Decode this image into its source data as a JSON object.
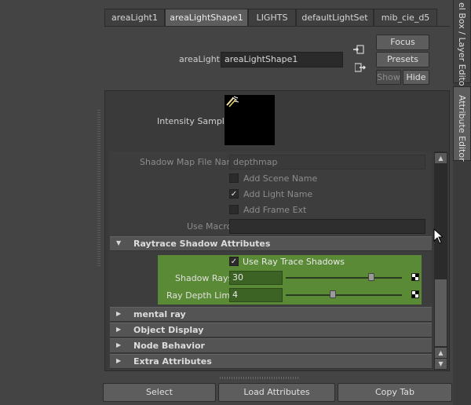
{
  "tabs": [
    "areaLight1",
    "areaLightShape1",
    "LIGHTS",
    "defaultLightSet",
    "mib_cie_d5"
  ],
  "node": {
    "label": "areaLight:",
    "value": "areaLightShape1"
  },
  "buttons": {
    "focus": "Focus",
    "presets": "Presets",
    "show": "Show",
    "hide": "Hide"
  },
  "intensity_sample": {
    "label": "Intensity Sample"
  },
  "shadow_map": {
    "file_name_label": "Shadow Map File Name",
    "file_name_value": "depthmap",
    "add_scene_name": "Add Scene Name",
    "add_light_name": "Add Light Name",
    "add_frame_ext": "Add Frame Ext",
    "use_macro_label": "Use Macro",
    "use_macro_value": ""
  },
  "raytrace": {
    "title": "Raytrace Shadow Attributes",
    "use_ray_trace_shadows": "Use Ray Trace Shadows",
    "shadow_rays_label": "Shadow Rays",
    "shadow_rays_value": "30",
    "ray_depth_label": "Ray Depth Limit",
    "ray_depth_value": "4"
  },
  "sections": [
    "mental ray",
    "Object Display",
    "Node Behavior",
    "Extra Attributes"
  ],
  "bottom_buttons": {
    "select": "Select",
    "load": "Load Attributes",
    "copy": "Copy Tab"
  },
  "side_tabs": {
    "channel_box": "el Box / Layer Editor",
    "attribute_editor": "Attribute Editor"
  },
  "colors": {
    "accent_green": "#5a8a35",
    "panel": "#444444"
  }
}
